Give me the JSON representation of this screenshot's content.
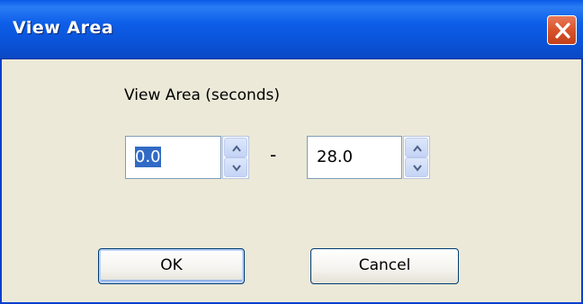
{
  "window": {
    "title": "View Area"
  },
  "dialog": {
    "label": "View Area (seconds)",
    "from_value": "0.0",
    "separator": "-",
    "to_value": "28.0"
  },
  "buttons": {
    "ok_label": "OK",
    "cancel_label": "Cancel"
  },
  "icons": {
    "close": "close-icon",
    "spin_up": "chevron-up-icon",
    "spin_down": "chevron-down-icon"
  },
  "colors": {
    "titlebar": "#0a52d6",
    "close_button": "#d9532a",
    "selection": "#316ac5",
    "window_background": "#ece9d8"
  }
}
